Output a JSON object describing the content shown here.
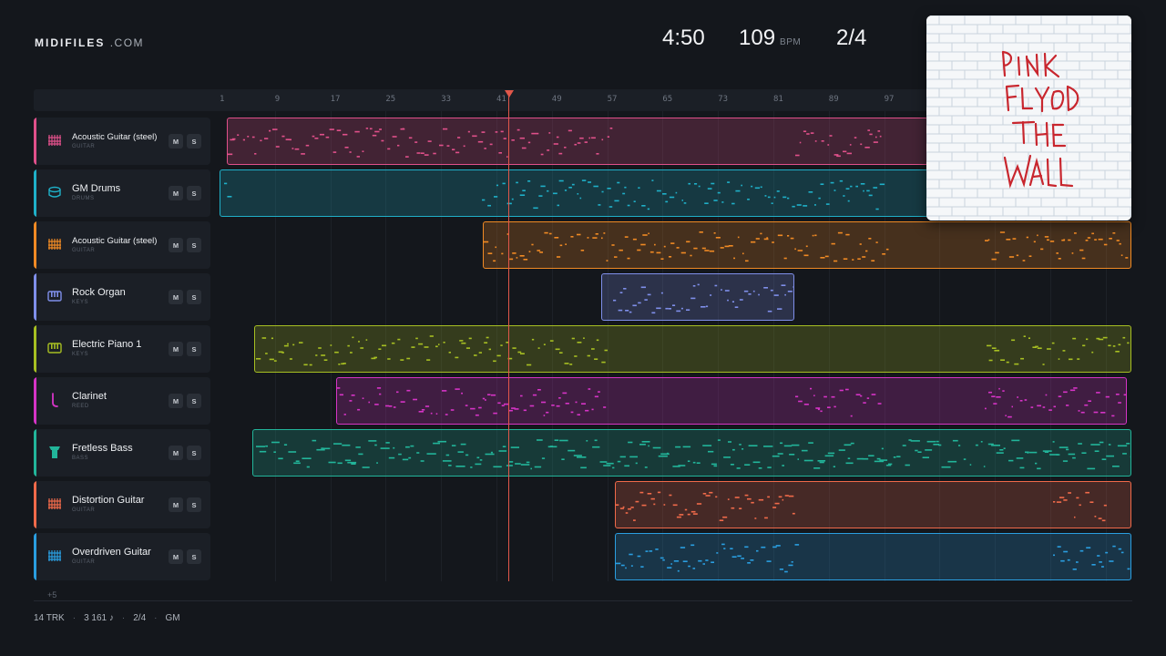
{
  "brand": {
    "name": "MIDIFILES",
    "domain": ".COM"
  },
  "stats": {
    "time": "4:50",
    "bpm": "109",
    "bpm_unit": "BPM",
    "time_signature": "2/4"
  },
  "ruler": {
    "bars": [
      "1",
      "9",
      "17",
      "25",
      "33",
      "41",
      "49",
      "57",
      "65",
      "73",
      "81",
      "89",
      "97"
    ]
  },
  "playhead_bar": 41,
  "tracks": [
    {
      "name": "Acoustic Guitar (steel)",
      "category": "GUITAR",
      "color": "#e0508a",
      "icon": "guitar-icon",
      "mute": "M",
      "solo": "S"
    },
    {
      "name": "GM Drums",
      "category": "DRUMS",
      "color": "#1fb0c8",
      "icon": "drum-icon",
      "mute": "M",
      "solo": "S"
    },
    {
      "name": "Acoustic Guitar (steel)",
      "category": "GUITAR",
      "color": "#f08a24",
      "icon": "guitar-icon",
      "mute": "M",
      "solo": "S"
    },
    {
      "name": "Rock Organ",
      "category": "KEYS",
      "color": "#7f8fea",
      "icon": "keyboard-icon",
      "mute": "M",
      "solo": "S"
    },
    {
      "name": "Electric Piano 1",
      "category": "KEYS",
      "color": "#a7bf22",
      "icon": "keyboard-icon",
      "mute": "M",
      "solo": "S"
    },
    {
      "name": "Clarinet",
      "category": "REED",
      "color": "#d634c6",
      "icon": "clarinet-icon",
      "mute": "M",
      "solo": "S"
    },
    {
      "name": "Fretless Bass",
      "category": "BASS",
      "color": "#22b59a",
      "icon": "bass-icon",
      "mute": "M",
      "solo": "S"
    },
    {
      "name": "Distortion Guitar",
      "category": "GUITAR",
      "color": "#f06a4a",
      "icon": "guitar-icon",
      "mute": "M",
      "solo": "S"
    },
    {
      "name": "Overdriven Guitar",
      "category": "GUITAR",
      "color": "#2a9ee0",
      "icon": "guitar-icon",
      "mute": "M",
      "solo": "S"
    }
  ],
  "more_tracks": "+5",
  "footer": {
    "tracks": "14 TRK",
    "notes": "3 161 ♪",
    "signature": "2/4",
    "standard": "GM"
  },
  "cover": {
    "line1": "PINK",
    "line2": "FLOYD",
    "line3": "THE",
    "line4": "WALL"
  }
}
